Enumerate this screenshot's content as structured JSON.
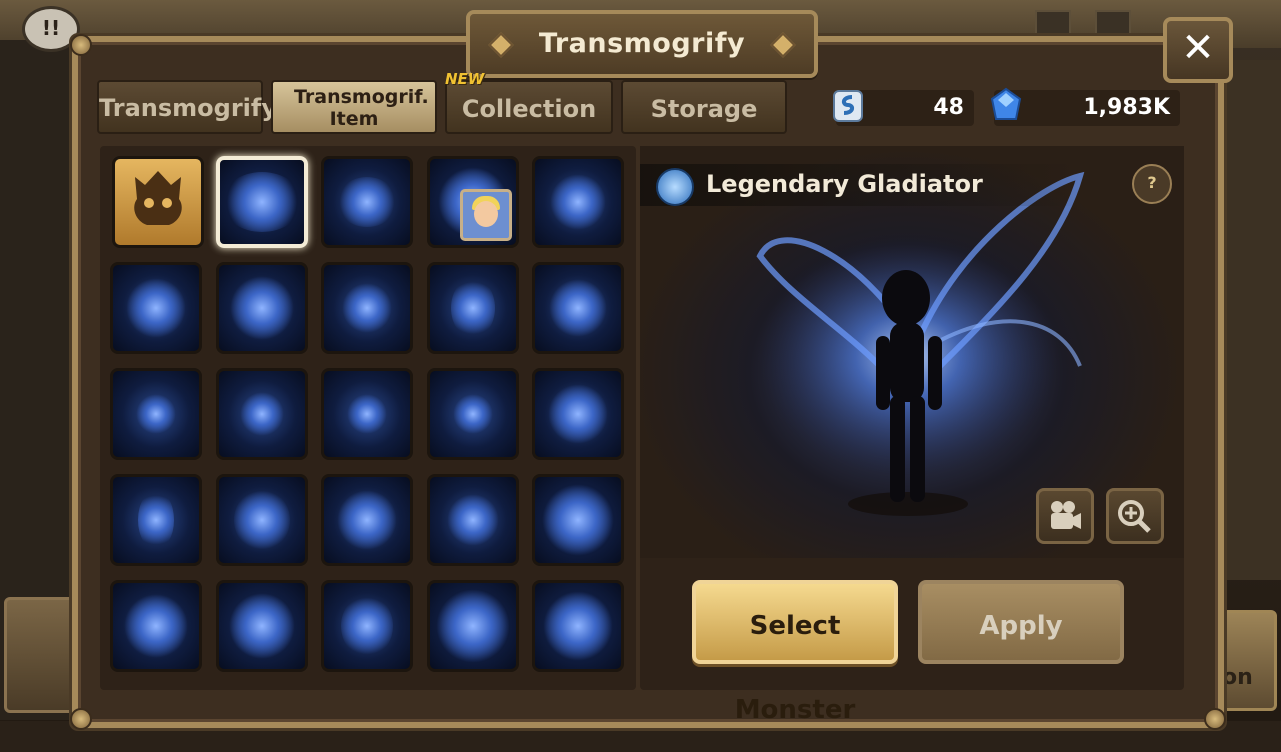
{
  "title": "Transmogrify",
  "tabs": [
    {
      "label": "Transmogrify",
      "active": false
    },
    {
      "label": "Transmogrif. Item",
      "active": true
    },
    {
      "label": "Collection",
      "active": false,
      "badge": "NEW"
    },
    {
      "label": "Storage",
      "active": false
    }
  ],
  "currency": {
    "scroll_icon": "transmog-scroll-icon",
    "scroll_value": "48",
    "crystal_icon": "crystal-icon",
    "crystal_value": "1,983K"
  },
  "preview": {
    "name": "Legendary Gladiator",
    "help_label": "?",
    "select_label": "Select Monster",
    "apply_label": "Apply"
  },
  "background": {
    "alert_label": "!!",
    "right_fragment": "on"
  },
  "colors": {
    "gold": "#c59b48",
    "panel": "#3d2e20",
    "frame": "#a68a5a",
    "effect_blue": "#3c66c7"
  }
}
